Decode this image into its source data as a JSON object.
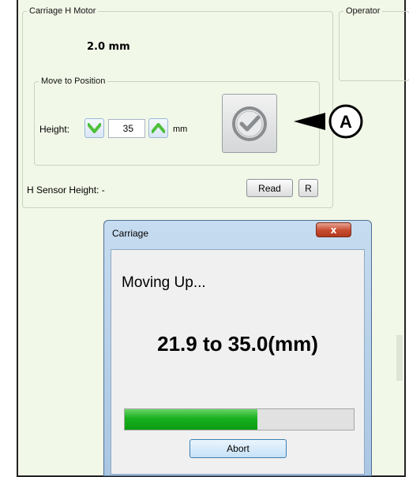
{
  "motor_group": {
    "legend": "Carriage H Motor",
    "current_value": "2.0 mm",
    "move_group": {
      "legend": "Move to Position",
      "height_label": "Height:",
      "height_value": "35",
      "unit": "mm",
      "decrease_icon": "chevron-down-icon",
      "increase_icon": "chevron-up-icon",
      "go_icon": "checkmark-circle-icon"
    },
    "sensor_label": "H Sensor Height: -",
    "read_label": "Read",
    "r_label": "R"
  },
  "operator_group": {
    "legend": "Operator"
  },
  "callout": {
    "label": "A"
  },
  "dialog": {
    "title": "Carriage",
    "close_label": "x",
    "status": "Moving Up...",
    "range": "21.9 to 35.0(mm)",
    "progress": 0.58,
    "abort_label": "Abort"
  },
  "colors": {
    "panel_bg": "#f2f8e8",
    "progress_green": "#18b01e",
    "stepper_green": "#4fbf3a",
    "dialog_frame": "#a9c6e3",
    "close_red": "#c74a2e"
  }
}
